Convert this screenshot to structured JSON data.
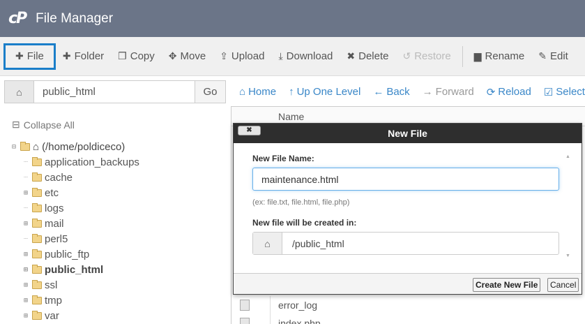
{
  "header": {
    "logo": "cP",
    "title": "File Manager"
  },
  "toolbar": {
    "file": "File",
    "folder": "Folder",
    "copy": "Copy",
    "move": "Move",
    "upload": "Upload",
    "download": "Download",
    "delete": "Delete",
    "restore": "Restore",
    "rename": "Rename",
    "edit": "Edit"
  },
  "pathbar": {
    "value": "public_html",
    "go": "Go"
  },
  "nav": {
    "home": "Home",
    "up": "Up One Level",
    "back": "Back",
    "forward": "Forward",
    "reload": "Reload",
    "select_all": "Select all"
  },
  "tree": {
    "collapse_all": "Collapse All",
    "root": "(/home/poldiceco)",
    "items": [
      {
        "label": "application_backups",
        "expandable": false
      },
      {
        "label": "cache",
        "expandable": false
      },
      {
        "label": "etc",
        "expandable": true
      },
      {
        "label": "logs",
        "expandable": false
      },
      {
        "label": "mail",
        "expandable": true
      },
      {
        "label": "perl5",
        "expandable": false
      },
      {
        "label": "public_ftp",
        "expandable": true
      },
      {
        "label": "public_html",
        "expandable": true,
        "bold": true
      },
      {
        "label": "ssl",
        "expandable": true
      },
      {
        "label": "tmp",
        "expandable": true
      },
      {
        "label": "var",
        "expandable": true
      }
    ]
  },
  "filelist": {
    "name_header": "Name",
    "rows": [
      "error_log",
      "index.php"
    ]
  },
  "modal": {
    "title": "New File",
    "close": "✖",
    "name_label": "New File Name:",
    "name_value": "maintenance.html",
    "hint": "(ex: file.txt, file.html, file.php)",
    "location_label": "New file will be created in:",
    "location_value": "/public_html",
    "create_button": "Create New File",
    "cancel_button": "Cancel"
  },
  "colors": {
    "header_bg": "#6b7588",
    "active_border": "#1a7ec9",
    "link": "#3a87c8",
    "modal_title_bg": "#2e2e2e"
  }
}
